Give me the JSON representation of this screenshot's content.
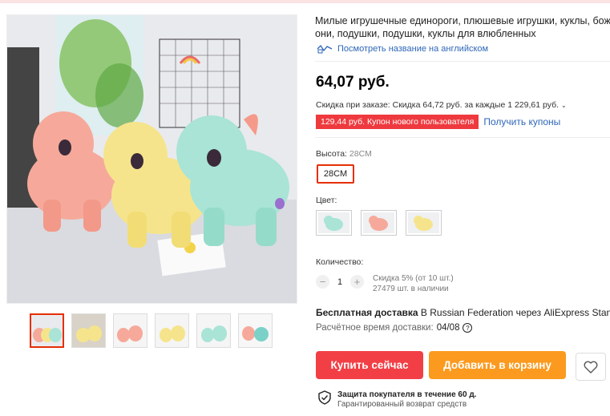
{
  "product": {
    "title_line1": "Милые игрушечные единороги, плюшевые игрушки, куклы, божьи",
    "title_line2": "они, подушки, подушки, куклы для влюбленных",
    "translate_link": "Посмотреть название на английском",
    "price": "64,07 руб.",
    "discount_text": "Скидка при заказе: Скидка 64,72 руб. за каждые 1 229,61 руб.",
    "coupon_label": "129,44 руб. Купон нового пользователя",
    "get_coupons": "Получить купоны"
  },
  "options": {
    "height_label": "Высота:",
    "height_value": "28CM",
    "height_option": "28CM",
    "color_label": "Цвет:",
    "colors": [
      "mint",
      "pink",
      "yellow"
    ]
  },
  "quantity": {
    "label": "Количество:",
    "minus": "−",
    "value": "1",
    "plus": "+",
    "bulk_discount": "Скидка 5% (от 10 шт.)",
    "stock": "27479 шт. в наличии"
  },
  "delivery": {
    "free_label": "Бесплатная доставка",
    "route_text": " В Russian Federation через AliExpress Standa",
    "eta_label": "Расчётное время доставки:",
    "eta_date": "04/08",
    "help_glyph": "?"
  },
  "actions": {
    "buy_now": "Купить сейчас",
    "add_to_cart": "Добавить в корзину"
  },
  "protection": {
    "title": "Защита покупателя в течение 60 д.",
    "subtitle": "Гарантированный возврат средств"
  },
  "colors_theme": {
    "accent_red": "#f23f46",
    "accent_orange": "#fb9a1e",
    "link_blue": "#2e66b8",
    "coupon_red": "#ee3a3f"
  }
}
